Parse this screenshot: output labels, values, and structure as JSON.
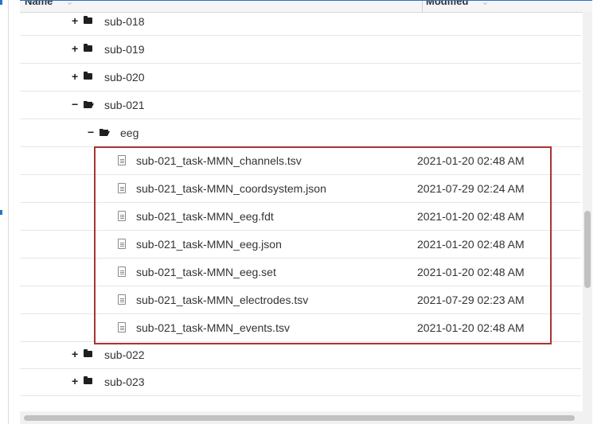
{
  "header": {
    "name_label": "Name",
    "modified_label": "Modified",
    "sort_glyphs": "⌃⌄"
  },
  "tree": {
    "folders_before": [
      {
        "label": "sub-018",
        "toggle": "+"
      },
      {
        "label": "sub-019",
        "toggle": "+"
      },
      {
        "label": "sub-020",
        "toggle": "+"
      }
    ],
    "open_folder": {
      "label": "sub-021",
      "toggle": "−"
    },
    "open_subfolder": {
      "label": "eeg",
      "toggle": "−"
    },
    "files": [
      {
        "name": "sub-021_task-MMN_channels.tsv",
        "modified": "2021-01-20 02:48 AM"
      },
      {
        "name": "sub-021_task-MMN_coordsystem.json",
        "modified": "2021-07-29 02:24 AM"
      },
      {
        "name": "sub-021_task-MMN_eeg.fdt",
        "modified": "2021-01-20 02:48 AM"
      },
      {
        "name": "sub-021_task-MMN_eeg.json",
        "modified": "2021-01-20 02:48 AM"
      },
      {
        "name": "sub-021_task-MMN_eeg.set",
        "modified": "2021-01-20 02:48 AM"
      },
      {
        "name": "sub-021_task-MMN_electrodes.tsv",
        "modified": "2021-07-29 02:23 AM"
      },
      {
        "name": "sub-021_task-MMN_events.tsv",
        "modified": "2021-01-20 02:48 AM"
      }
    ],
    "folders_after": [
      {
        "label": "sub-022",
        "toggle": "+"
      },
      {
        "label": "sub-023",
        "toggle": "+"
      }
    ]
  },
  "icons": {
    "closed_folder": "folder-icon",
    "open_folder": "folder-open-icon",
    "file": "file-icon"
  },
  "colors": {
    "highlight_border": "#aa3333",
    "accent": "#2a72c7"
  }
}
